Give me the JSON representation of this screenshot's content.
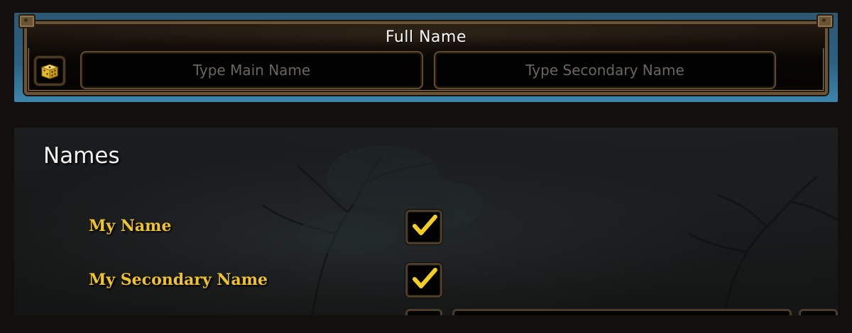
{
  "header": {
    "title": "Full Name",
    "randomize_icon": "dice-icon",
    "main_name_placeholder": "Type Main Name",
    "main_name_value": "",
    "secondary_name_placeholder": "Type Secondary Name",
    "secondary_name_value": ""
  },
  "names_panel": {
    "title": "Names",
    "options": [
      {
        "label": "My Name",
        "checked": true
      },
      {
        "label": "My Secondary Name",
        "checked": true
      }
    ]
  },
  "colors": {
    "accent_gold": "#f0c32a",
    "check_yellow": "#f4cf22",
    "frame_bronze": "#6b5436",
    "frame_blue": "#3d86ad"
  }
}
